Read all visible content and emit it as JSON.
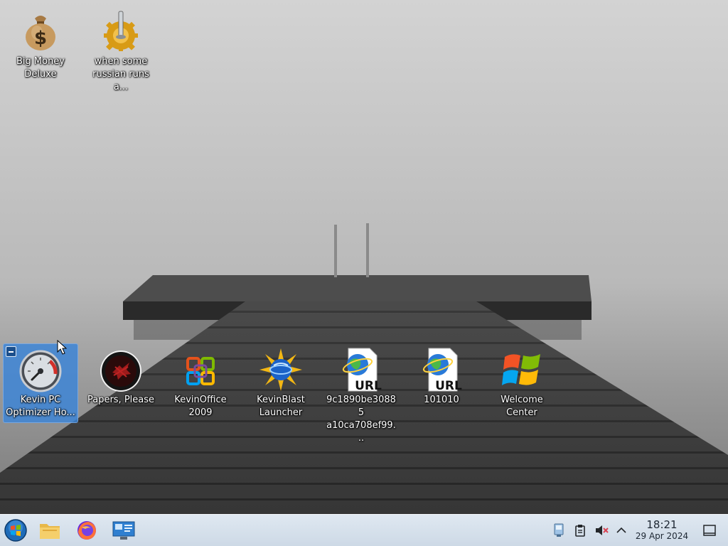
{
  "desktop": {
    "icons": [
      {
        "label": "Big Money Deluxe",
        "icon": "money-bag-icon"
      },
      {
        "label": "when some russian runs a...",
        "icon": "gear-lever-icon"
      },
      {
        "label": "Kevin PC Optimizer Ho...",
        "icon": "speedometer-icon",
        "selected": true
      },
      {
        "label": "Papers, Please",
        "icon": "papers-please-seal-icon"
      },
      {
        "label": "KevinOffice 2009",
        "icon": "office-logo-icon"
      },
      {
        "label": "KevinBlast Launcher",
        "icon": "sunburst-globe-icon"
      },
      {
        "label": "9c1890be30885 a10ca708ef99...",
        "icon": "url-shortcut-icon"
      },
      {
        "label": "101010",
        "icon": "url-shortcut-icon"
      },
      {
        "label": "Welcome Center",
        "icon": "windows-flag-icon"
      }
    ],
    "url_badge": "URL"
  },
  "taskbar": {
    "start_icon": "start-orb-icon",
    "pinned": [
      "file-manager-icon",
      "firefox-icon",
      "remote-desktop-icon"
    ],
    "tray": [
      "network-icon",
      "clipboard-icon",
      "volume-muted-icon",
      "chevron-up-icon"
    ],
    "clock": {
      "time": "18:21",
      "date": "29 Apr 2024"
    },
    "show_desktop_icon": "show-desktop-icon"
  },
  "colors": {
    "selection": "#3d85d6",
    "taskbar_top": "#dfe8f1",
    "taskbar_bottom": "#cdd9e6"
  }
}
